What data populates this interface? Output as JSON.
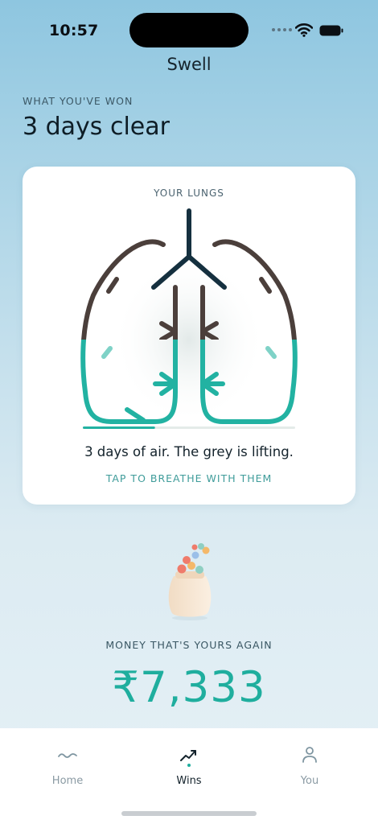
{
  "status_bar": {
    "time": "10:57",
    "icons": [
      "signal-dots",
      "wifi-icon",
      "battery-icon"
    ]
  },
  "header": {
    "title": "Swell"
  },
  "summary": {
    "eyebrow": "WHAT YOU'VE WON",
    "headline": "3 days clear"
  },
  "lungs_card": {
    "label": "YOUR LUNGS",
    "caption": "3 days of air. The grey is lifting.",
    "action": "TAP TO BREATHE WITH THEM",
    "recovery_progress": 0.34,
    "colors": {
      "healed": "#22b2a2",
      "grey": "#4b3f3b",
      "airway": "#15303f"
    }
  },
  "money": {
    "label": "MONEY THAT'S YOURS AGAIN",
    "value": "₹7,333",
    "color": "#1fae9e",
    "icon": "coin-jar-icon"
  },
  "tab_bar": {
    "tabs": [
      {
        "label": "Home",
        "icon": "wave-icon",
        "active": false
      },
      {
        "label": "Wins",
        "icon": "trend-up-icon",
        "active": true
      },
      {
        "label": "You",
        "icon": "person-icon",
        "active": false
      }
    ]
  }
}
